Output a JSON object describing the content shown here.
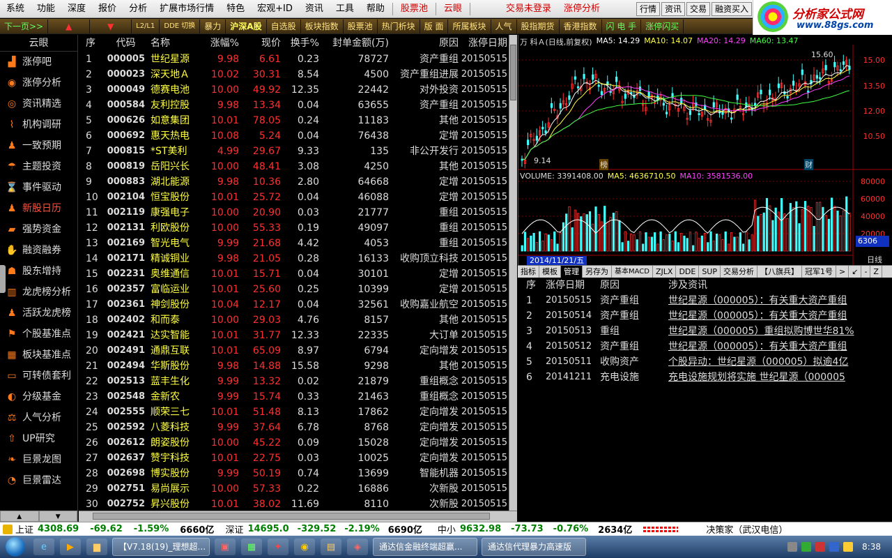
{
  "menu": {
    "items": [
      "系统",
      "功能",
      "深度",
      "报价",
      "分析",
      "扩展市场行情",
      "特色",
      "宏观+ID",
      "资讯",
      "工具",
      "帮助"
    ],
    "special": [
      "股票池",
      "云眼"
    ],
    "login_status": "交易未登录",
    "zt_analysis": "涨停分析",
    "right_buttons": [
      "行情",
      "资讯",
      "交易",
      "融资买入"
    ]
  },
  "logo": {
    "title": "分析家公式网",
    "url": "www.88gs.com"
  },
  "toolbar": {
    "items": [
      "下一页>>",
      "▲",
      "▼",
      "L2/L1",
      "DDE 切换",
      "暴力",
      "沪深A股",
      "自选股",
      "板块指数",
      "股票池",
      "热门析块",
      "版 面",
      "所属板块",
      "人气",
      "股指期货",
      "香港指数",
      "闪 电 手",
      "涨停闪买"
    ]
  },
  "sidebar": {
    "title": "云眼",
    "items": [
      {
        "label": "涨停吧",
        "icon": "chart-icon"
      },
      {
        "label": "涨停分析",
        "icon": "coin-icon"
      },
      {
        "label": "资讯精选",
        "icon": "target-icon"
      },
      {
        "label": "机构调研",
        "icon": "line-icon"
      },
      {
        "label": "一致预期",
        "icon": "person-icon"
      },
      {
        "label": "主题投资",
        "icon": "umbrella-icon"
      },
      {
        "label": "事件驱动",
        "icon": "hourglass-icon"
      },
      {
        "label": "新股日历",
        "icon": "person-icon"
      },
      {
        "label": "强势资金",
        "icon": "briefcase-icon"
      },
      {
        "label": "融资融券",
        "icon": "hand-icon"
      },
      {
        "label": "股东增持",
        "icon": "people-icon"
      },
      {
        "label": "龙虎榜分析",
        "icon": "bar-icon"
      },
      {
        "label": "活跃龙虎榜",
        "icon": "person-icon"
      },
      {
        "label": "个股基准点",
        "icon": "flag-icon"
      },
      {
        "label": "板块基准点",
        "icon": "grid-icon"
      },
      {
        "label": "可转债套利",
        "icon": "ticket-icon"
      },
      {
        "label": "分级基金",
        "icon": "pig-icon"
      },
      {
        "label": "人气分析",
        "icon": "scale-icon"
      },
      {
        "label": "UP研究",
        "icon": "up-icon"
      },
      {
        "label": "巨景龙图",
        "icon": "dragon-icon"
      },
      {
        "label": "巨景雷达",
        "icon": "radar-icon"
      }
    ],
    "active_index": 7
  },
  "table": {
    "columns": [
      "序",
      "代码",
      "名称",
      "涨幅%",
      "现价",
      "换手%",
      "封单金额(万)",
      "原因",
      "涨停日期"
    ],
    "rows": [
      [
        "1",
        "000005",
        "世纪星源",
        "9.98",
        "6.61",
        "0.23",
        "78727",
        "资产重组",
        "20150515"
      ],
      [
        "2",
        "000023",
        "深天地Ａ",
        "10.02",
        "30.31",
        "8.54",
        "4500",
        "资产重组进展",
        "20150515"
      ],
      [
        "3",
        "000049",
        "德赛电池",
        "10.00",
        "49.92",
        "12.35",
        "22442",
        "对外投资",
        "20150515"
      ],
      [
        "4",
        "000584",
        "友利控股",
        "9.98",
        "13.34",
        "0.04",
        "63655",
        "资产重组",
        "20150515"
      ],
      [
        "5",
        "000626",
        "如意集团",
        "10.01",
        "78.05",
        "0.24",
        "11183",
        "其他",
        "20150515"
      ],
      [
        "6",
        "000692",
        "惠天热电",
        "10.08",
        "5.24",
        "0.04",
        "76438",
        "定增",
        "20150515"
      ],
      [
        "7",
        "000815",
        "*ST美利",
        "4.99",
        "29.67",
        "9.33",
        "135",
        "非公开发行",
        "20150515"
      ],
      [
        "8",
        "000819",
        "岳阳兴长",
        "10.00",
        "48.41",
        "3.08",
        "4250",
        "其他",
        "20150515"
      ],
      [
        "9",
        "000883",
        "湖北能源",
        "9.98",
        "10.36",
        "2.80",
        "64668",
        "定增",
        "20150515"
      ],
      [
        "10",
        "002104",
        "恒宝股份",
        "10.01",
        "25.72",
        "0.04",
        "46088",
        "定增",
        "20150515"
      ],
      [
        "11",
        "002119",
        "康强电子",
        "10.00",
        "20.90",
        "0.03",
        "21777",
        "重组",
        "20150515"
      ],
      [
        "12",
        "002131",
        "利欧股份",
        "10.00",
        "55.33",
        "0.19",
        "49097",
        "重组",
        "20150515"
      ],
      [
        "13",
        "002169",
        "智光电气",
        "9.99",
        "21.68",
        "4.42",
        "4053",
        "重组",
        "20150515"
      ],
      [
        "14",
        "002171",
        "精诚铜业",
        "9.98",
        "21.05",
        "0.28",
        "16133",
        "收购顶立科技",
        "20150515"
      ],
      [
        "15",
        "002231",
        "奥维通信",
        "10.01",
        "15.71",
        "0.04",
        "30101",
        "定增",
        "20150515"
      ],
      [
        "16",
        "002357",
        "富临运业",
        "10.01",
        "25.60",
        "0.25",
        "10399",
        "定增",
        "20150515"
      ],
      [
        "17",
        "002361",
        "神剑股份",
        "10.04",
        "12.17",
        "0.04",
        "32561",
        "收购嘉业航空",
        "20150515"
      ],
      [
        "18",
        "002402",
        "和而泰",
        "10.00",
        "29.03",
        "4.76",
        "8157",
        "其他",
        "20150515"
      ],
      [
        "19",
        "002421",
        "达实智能",
        "10.01",
        "31.77",
        "12.33",
        "22335",
        "大订单",
        "20150515"
      ],
      [
        "20",
        "002491",
        "通鼎互联",
        "10.01",
        "65.09",
        "8.97",
        "6794",
        "定向增发",
        "20150515"
      ],
      [
        "21",
        "002494",
        "华斯股份",
        "9.98",
        "14.88",
        "15.58",
        "9298",
        "其他",
        "20150515"
      ],
      [
        "22",
        "002513",
        "蓝丰生化",
        "9.99",
        "13.32",
        "0.02",
        "21879",
        "重组概念",
        "20150515"
      ],
      [
        "23",
        "002548",
        "金新农",
        "9.99",
        "15.74",
        "0.33",
        "21463",
        "重组概念",
        "20150515"
      ],
      [
        "24",
        "002555",
        "顺荣三七",
        "10.01",
        "51.48",
        "8.13",
        "17862",
        "定向增发",
        "20150515"
      ],
      [
        "25",
        "002592",
        "八菱科技",
        "9.99",
        "37.64",
        "6.78",
        "8768",
        "定向增发",
        "20150515"
      ],
      [
        "26",
        "002612",
        "朗姿股份",
        "10.00",
        "45.22",
        "0.09",
        "15028",
        "定向增发",
        "20150515"
      ],
      [
        "27",
        "002637",
        "赞宇科技",
        "10.01",
        "22.75",
        "0.03",
        "10025",
        "定向增发",
        "20150515"
      ],
      [
        "28",
        "002698",
        "博实股份",
        "9.99",
        "50.19",
        "0.74",
        "13699",
        "智能机器",
        "20150515"
      ],
      [
        "29",
        "002751",
        "易尚展示",
        "10.00",
        "57.33",
        "0.22",
        "16886",
        "次新股",
        "20150515"
      ],
      [
        "30",
        "002752",
        "昇兴股份",
        "10.01",
        "38.02",
        "11.69",
        "8110",
        "次新股",
        "20150515"
      ]
    ]
  },
  "chart": {
    "title": "万 科Ａ(日线,前复权)",
    "ma5": "MA5: 14.29",
    "ma10": "MA10: 14.07",
    "ma20": "MA20: 14.29",
    "ma60": "MA60: 13.47",
    "high_label": "15.60",
    "low_label": "9.14",
    "y_labels": [
      "15.00",
      "13.50",
      "12.00",
      "10.50"
    ],
    "marks": [
      "榜",
      "财"
    ],
    "vol_title": "VOLUME: 3391408.00",
    "vol_ma5": "MA5: 4636710.50",
    "vol_ma10": "MA10: 3581536.00",
    "vol_y_labels": [
      "80000",
      "60000",
      "40000",
      "20000"
    ],
    "vol_box": "6306",
    "date_label": "2014/11/21/五",
    "period": "日线",
    "colors": {
      "ma5": "#ffffff",
      "ma10": "#ffff40",
      "ma20": "#ff40ff",
      "ma60": "#40ff40",
      "up": "#ff3030",
      "down": "#40ffff"
    }
  },
  "right_tabs": [
    "指标",
    "模板",
    "管理",
    "另存为",
    "基本MACD",
    "ZJLX",
    "DDE",
    "SUP",
    "交易分析",
    "【八旗兵】",
    "冠军1号",
    ">",
    "↙",
    "-",
    "Z"
  ],
  "news": {
    "columns": [
      "序",
      "涨停日期",
      "原因",
      "涉及资讯"
    ],
    "rows": [
      [
        "1",
        "20150515",
        "资产重组",
        "世纪星源（000005）：有关重大资产重组"
      ],
      [
        "2",
        "20150514",
        "资产重组",
        "世纪星源（000005）：有关重大资产重组"
      ],
      [
        "3",
        "20150513",
        "重组",
        "世纪星源（000005）重组拟购博世华81%"
      ],
      [
        "4",
        "20150512",
        "资产重组",
        "世纪星源（000005）：有关重大资产重组"
      ],
      [
        "5",
        "20150511",
        "收购资产",
        "个股异动：世纪星源（000005）拟逾4亿"
      ],
      [
        "6",
        "20141211",
        "充电设施",
        "充电设施规划将实施 世纪星源（000005"
      ]
    ]
  },
  "status": {
    "sh_label": "上证",
    "sh": [
      "4308.69",
      "-69.62",
      "-1.59%",
      "6660亿"
    ],
    "sz_label": "深证",
    "sz": [
      "14695.0",
      "-329.52",
      "-2.19%",
      "6690亿"
    ],
    "zx_label": "中小",
    "zx": [
      "9632.98",
      "-73.73",
      "-0.76%",
      "2634亿"
    ],
    "broker": "决策家（武汉电信）"
  },
  "taskbar": {
    "tasks": [
      "【V7.18(19)_理想超...",
      "通达信金融终端超赢...",
      "通达信代理暴力高速版"
    ],
    "clock": "8:38"
  }
}
